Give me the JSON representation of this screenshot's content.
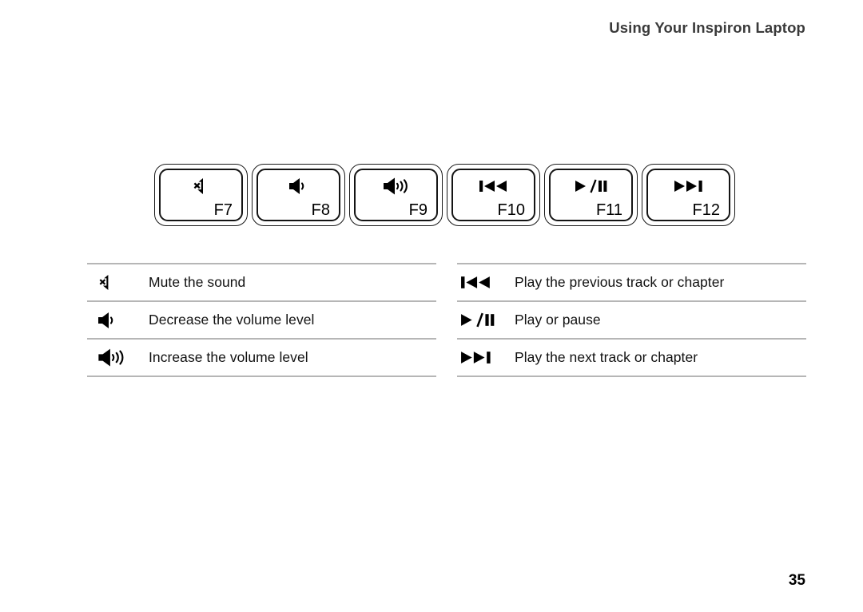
{
  "header": {
    "title": "Using Your Inspiron Laptop",
    "color": "#3a3a3a"
  },
  "keyboard_row": {
    "keys": [
      {
        "label": "F7",
        "icon": "volume-mute-icon"
      },
      {
        "label": "F8",
        "icon": "volume-down-icon"
      },
      {
        "label": "F9",
        "icon": "volume-up-icon"
      },
      {
        "label": "F10",
        "icon": "previous-track-icon"
      },
      {
        "label": "F11",
        "icon": "play-pause-icon"
      },
      {
        "label": "F12",
        "icon": "next-track-icon"
      }
    ]
  },
  "legend": {
    "left_column": [
      {
        "icon": "volume-mute-icon",
        "description": "Mute the sound"
      },
      {
        "icon": "volume-down-icon",
        "description": "Decrease the volume level"
      },
      {
        "icon": "volume-up-icon",
        "description": "Increase the volume level"
      }
    ],
    "right_column": [
      {
        "icon": "previous-track-icon",
        "description": "Play the previous track or chapter"
      },
      {
        "icon": "play-pause-icon",
        "description": "Play or pause"
      },
      {
        "icon": "next-track-icon",
        "description": "Play the next track or chapter"
      }
    ],
    "rule_color": "#b6b6b6"
  },
  "footer": {
    "page_number": "35"
  }
}
